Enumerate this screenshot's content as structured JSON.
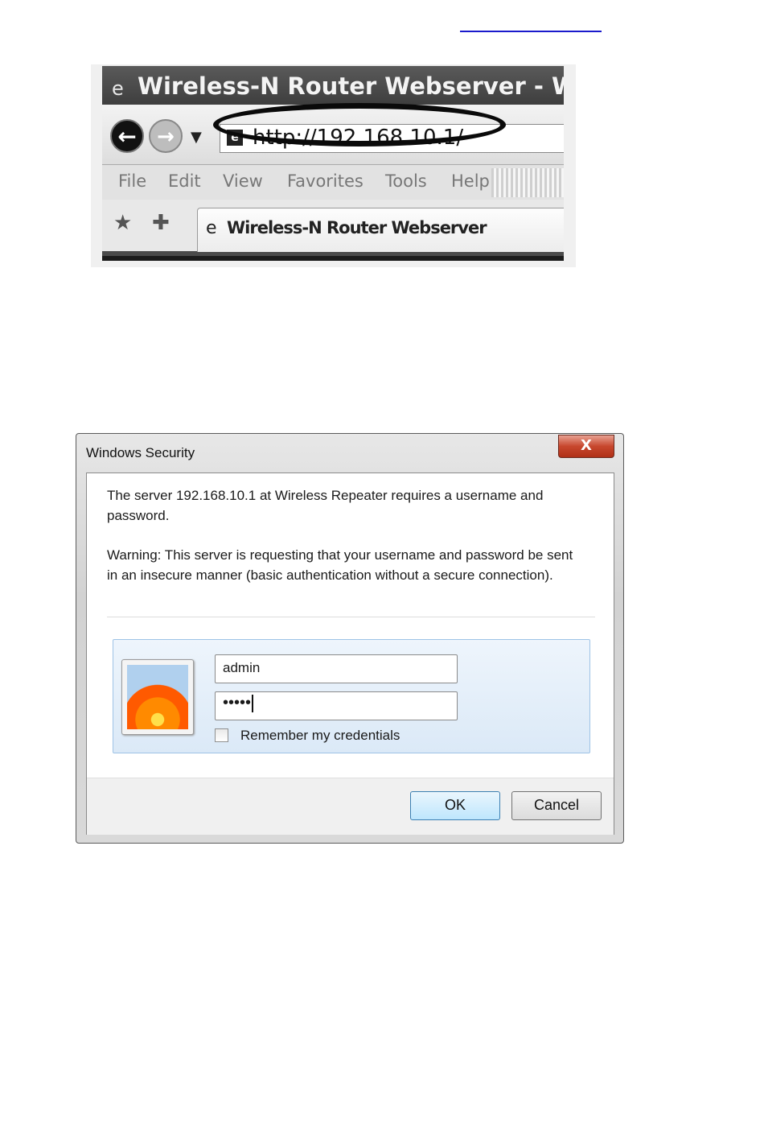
{
  "browser": {
    "window_title": "Wireless-N Router Webserver - W",
    "url": "http://192.168.10.1/",
    "menu": [
      "File",
      "Edit",
      "View",
      "Favorites",
      "Tools",
      "Help"
    ],
    "tab_label": "Wireless-N Router Webserver",
    "icons": {
      "back": "back-arrow-icon",
      "forward": "forward-arrow-icon",
      "favorites": "star-icon",
      "add_favorite": "add-star-icon"
    }
  },
  "dialog": {
    "title": "Windows Security",
    "close_glyph": "X",
    "message": "The server 192.168.10.1 at Wireless Repeater requires a username and password.",
    "warning": "Warning: This server is requesting that your username and password be sent in an insecure manner (basic authentication without a secure connection).",
    "username_value": "admin",
    "password_mask": "•••••",
    "remember_label": "Remember my credentials",
    "remember_checked": false,
    "ok_label": "OK",
    "cancel_label": "Cancel",
    "colors": {
      "close_button": "#c7472d",
      "ok_border": "#3c7fb1",
      "panel_border": "#9ec3e6"
    }
  }
}
